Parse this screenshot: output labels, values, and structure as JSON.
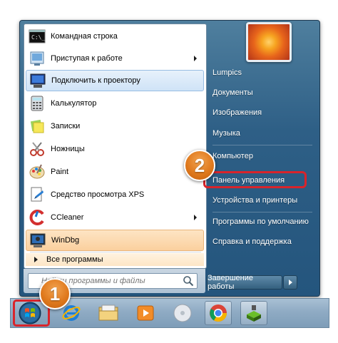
{
  "start_menu": {
    "programs": [
      {
        "label": "Командная строка",
        "icon": "cmd-icon",
        "submenu": false
      },
      {
        "label": "Приступая к работе",
        "icon": "getting-started-icon",
        "submenu": true
      },
      {
        "label": "Подключить к проектору",
        "icon": "projector-icon",
        "submenu": false
      },
      {
        "label": "Калькулятор",
        "icon": "calculator-icon",
        "submenu": false
      },
      {
        "label": "Записки",
        "icon": "sticky-notes-icon",
        "submenu": false
      },
      {
        "label": "Ножницы",
        "icon": "snipping-tool-icon",
        "submenu": false
      },
      {
        "label": "Paint",
        "icon": "paint-icon",
        "submenu": false
      },
      {
        "label": "Средство просмотра XPS",
        "icon": "xps-viewer-icon",
        "submenu": false
      },
      {
        "label": "CCleaner",
        "icon": "ccleaner-icon",
        "submenu": true
      },
      {
        "label": "WinDbg",
        "icon": "windbg-icon",
        "submenu": false
      }
    ],
    "all_programs": "Все программы",
    "search_placeholder": "Найти программы и файлы",
    "right_items": [
      "Lumpics",
      "Документы",
      "Изображения",
      "Музыка",
      "Компьютер",
      "Панель управления",
      "Устройства и принтеры",
      "Программы по умолчанию",
      "Справка и поддержка"
    ],
    "shutdown_label": "Завершение работы"
  },
  "annotations": {
    "badge_1": "1",
    "badge_2": "2",
    "highlight_color": "#d8242b",
    "badge_color": "#e07a1e"
  },
  "taskbar": {
    "items": [
      "start-orb-icon",
      "internet-explorer-icon",
      "explorer-folder-icon",
      "media-player-icon",
      "disc-icon",
      "chrome-icon",
      "app-icon"
    ]
  }
}
